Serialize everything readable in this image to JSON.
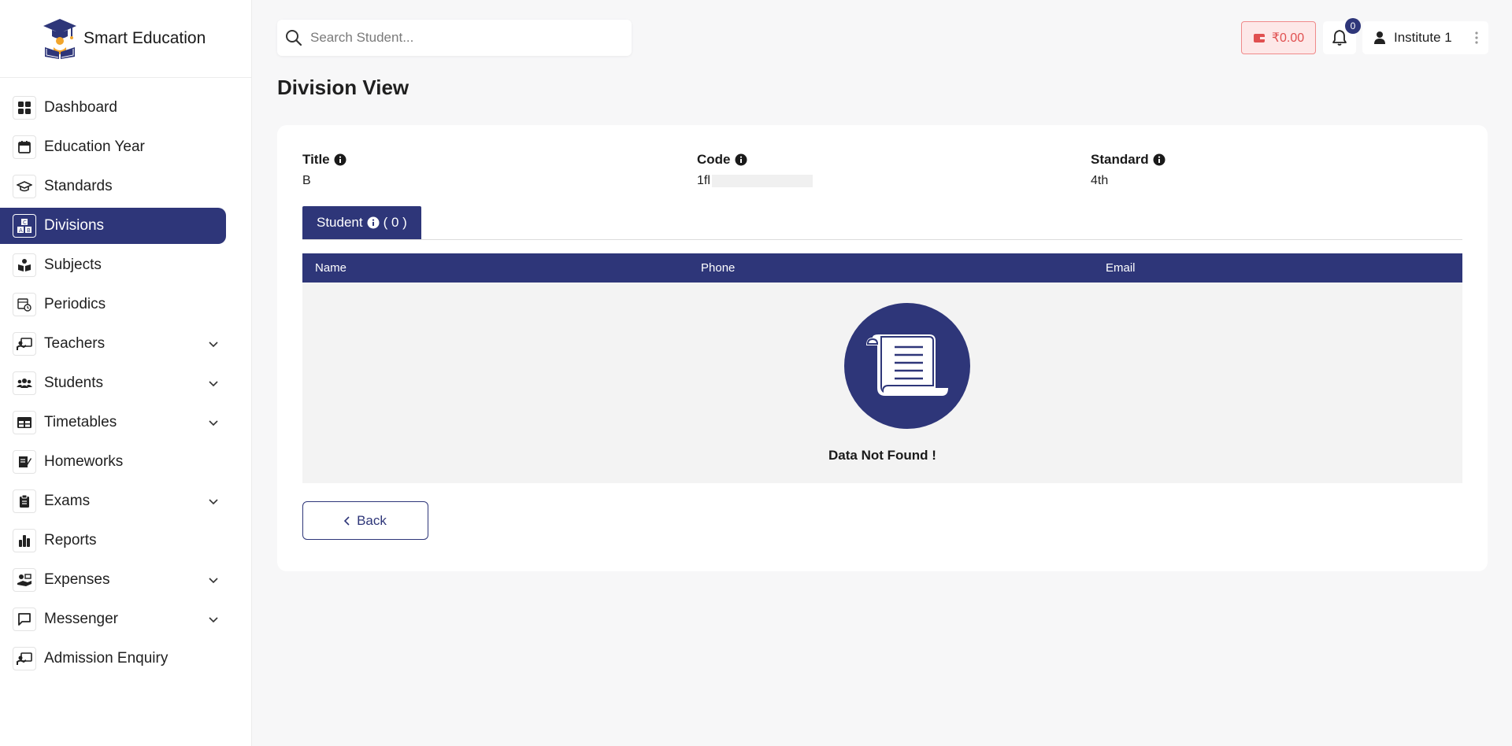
{
  "brand": {
    "name": "Smart Education"
  },
  "sidebar": {
    "items": [
      {
        "label": "Dashboard",
        "icon": "dashboard-icon",
        "active": false,
        "has_chevron": false
      },
      {
        "label": "Education Year",
        "icon": "calendar-icon",
        "active": false,
        "has_chevron": false
      },
      {
        "label": "Standards",
        "icon": "graduation-cap-icon",
        "active": false,
        "has_chevron": false
      },
      {
        "label": "Divisions",
        "icon": "abc-blocks-icon",
        "active": true,
        "has_chevron": false
      },
      {
        "label": "Subjects",
        "icon": "book-reader-icon",
        "active": false,
        "has_chevron": false
      },
      {
        "label": "Periodics",
        "icon": "calendar-clock-icon",
        "active": false,
        "has_chevron": false
      },
      {
        "label": "Teachers",
        "icon": "chalkboard-teacher-icon",
        "active": false,
        "has_chevron": true
      },
      {
        "label": "Students",
        "icon": "users-icon",
        "active": false,
        "has_chevron": true
      },
      {
        "label": "Timetables",
        "icon": "table-icon",
        "active": false,
        "has_chevron": true
      },
      {
        "label": "Homeworks",
        "icon": "pen-paper-icon",
        "active": false,
        "has_chevron": false
      },
      {
        "label": "Exams",
        "icon": "clipboard-icon",
        "active": false,
        "has_chevron": true
      },
      {
        "label": "Reports",
        "icon": "bar-chart-icon",
        "active": false,
        "has_chevron": false
      },
      {
        "label": "Expenses",
        "icon": "hand-money-icon",
        "active": false,
        "has_chevron": true
      },
      {
        "label": "Messenger",
        "icon": "message-icon",
        "active": false,
        "has_chevron": true
      },
      {
        "label": "Admission Enquiry",
        "icon": "chalkboard-teacher-icon",
        "active": false,
        "has_chevron": false
      }
    ]
  },
  "topbar": {
    "search_placeholder": "Search Student...",
    "wallet_amount": "₹0.00",
    "notification_count": "0",
    "user_name": "Institute 1"
  },
  "page": {
    "title": "Division View"
  },
  "division": {
    "title_label": "Title",
    "title_value": "B",
    "code_label": "Code",
    "code_value": "1fl",
    "standard_label": "Standard",
    "standard_value": "4th"
  },
  "tab": {
    "label": "Student",
    "count": "( 0 )"
  },
  "table": {
    "columns": [
      "Name",
      "Phone",
      "Email"
    ],
    "empty_text": "Data Not Found !"
  },
  "back_button": {
    "label": "Back"
  },
  "colors": {
    "primary": "#2e3679",
    "wallet_bg": "#fde8e8",
    "wallet_text": "#e05050"
  }
}
